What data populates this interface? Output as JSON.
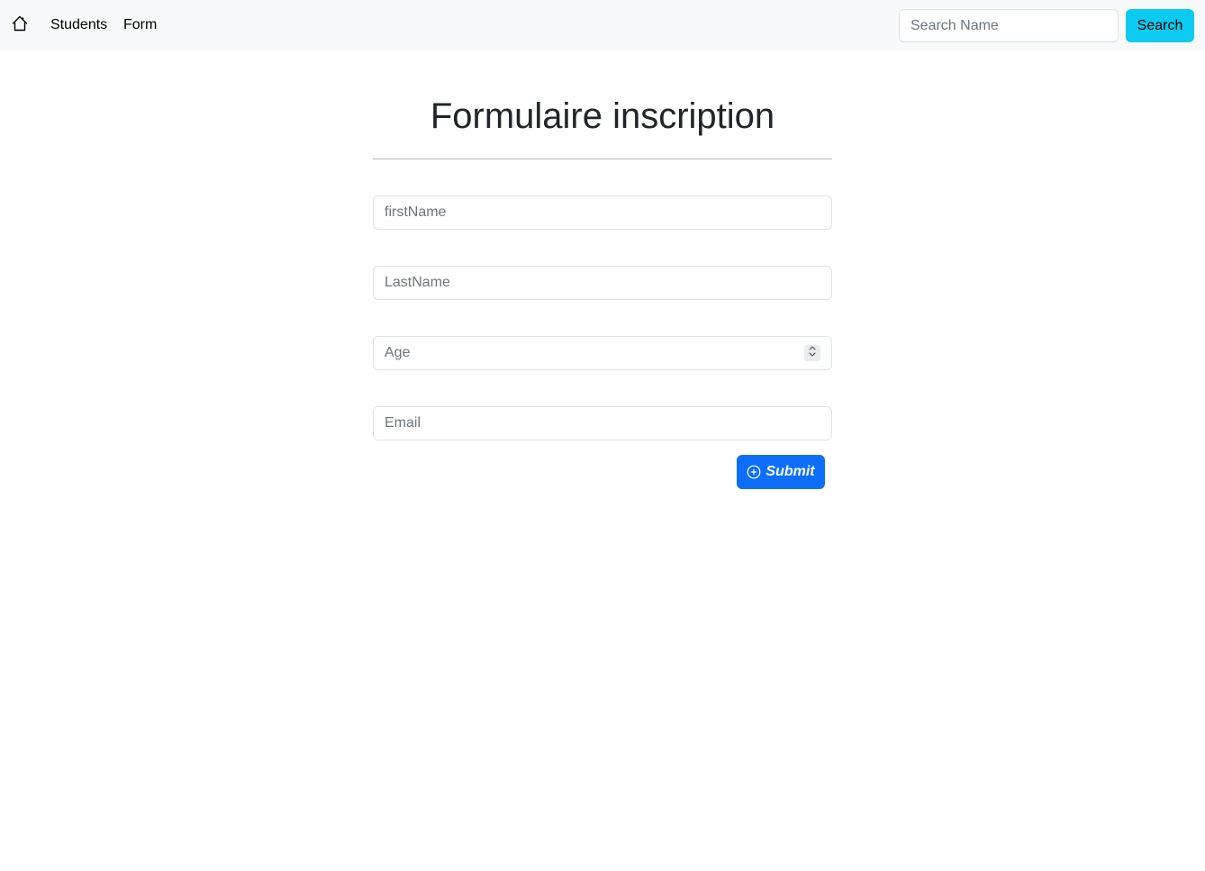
{
  "navbar": {
    "home_icon": "house-icon",
    "links": [
      {
        "label": "Students"
      },
      {
        "label": "Form"
      }
    ],
    "search": {
      "placeholder": "Search Name",
      "button_label": "Search",
      "button_color": "#0dcaf0"
    },
    "background": "#f8f9fa"
  },
  "form": {
    "title": "Formulaire inscription",
    "fields": {
      "first_name": {
        "placeholder": "firstName",
        "value": ""
      },
      "last_name": {
        "placeholder": "LastName",
        "value": ""
      },
      "age": {
        "placeholder": "Age",
        "value": ""
      },
      "email": {
        "placeholder": "Email",
        "value": ""
      }
    },
    "submit": {
      "label": "Submit",
      "icon": "plus-circle-icon",
      "color": "#0d6efd"
    }
  }
}
